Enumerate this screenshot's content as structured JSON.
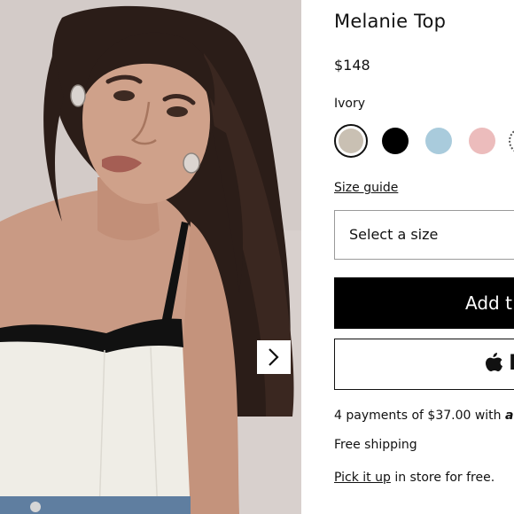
{
  "product": {
    "title": "Melanie Top",
    "price": "$148",
    "selected_color": "Ivory",
    "swatches": [
      {
        "name": "Ivory",
        "color": "#c9c0b3",
        "selected": true
      },
      {
        "name": "Black",
        "color": "#000000"
      },
      {
        "name": "Light Blue",
        "color": "#a9cbdc"
      },
      {
        "name": "Pink",
        "color": "#ecbcbc"
      },
      {
        "name": "Pattern",
        "color": "#ffffff"
      }
    ]
  },
  "size": {
    "guide_label": "Size guide",
    "select_placeholder": "Select a size"
  },
  "actions": {
    "add_label": "Add t",
    "pay_label": "P"
  },
  "info": {
    "installments_text": "4 payments of $37.00 with ",
    "installments_brand": "af",
    "shipping_text": "Free shipping",
    "pickup_link": "Pick it up",
    "pickup_text": " in store for free."
  },
  "gallery": {
    "next_icon": "chevron-right-icon"
  }
}
